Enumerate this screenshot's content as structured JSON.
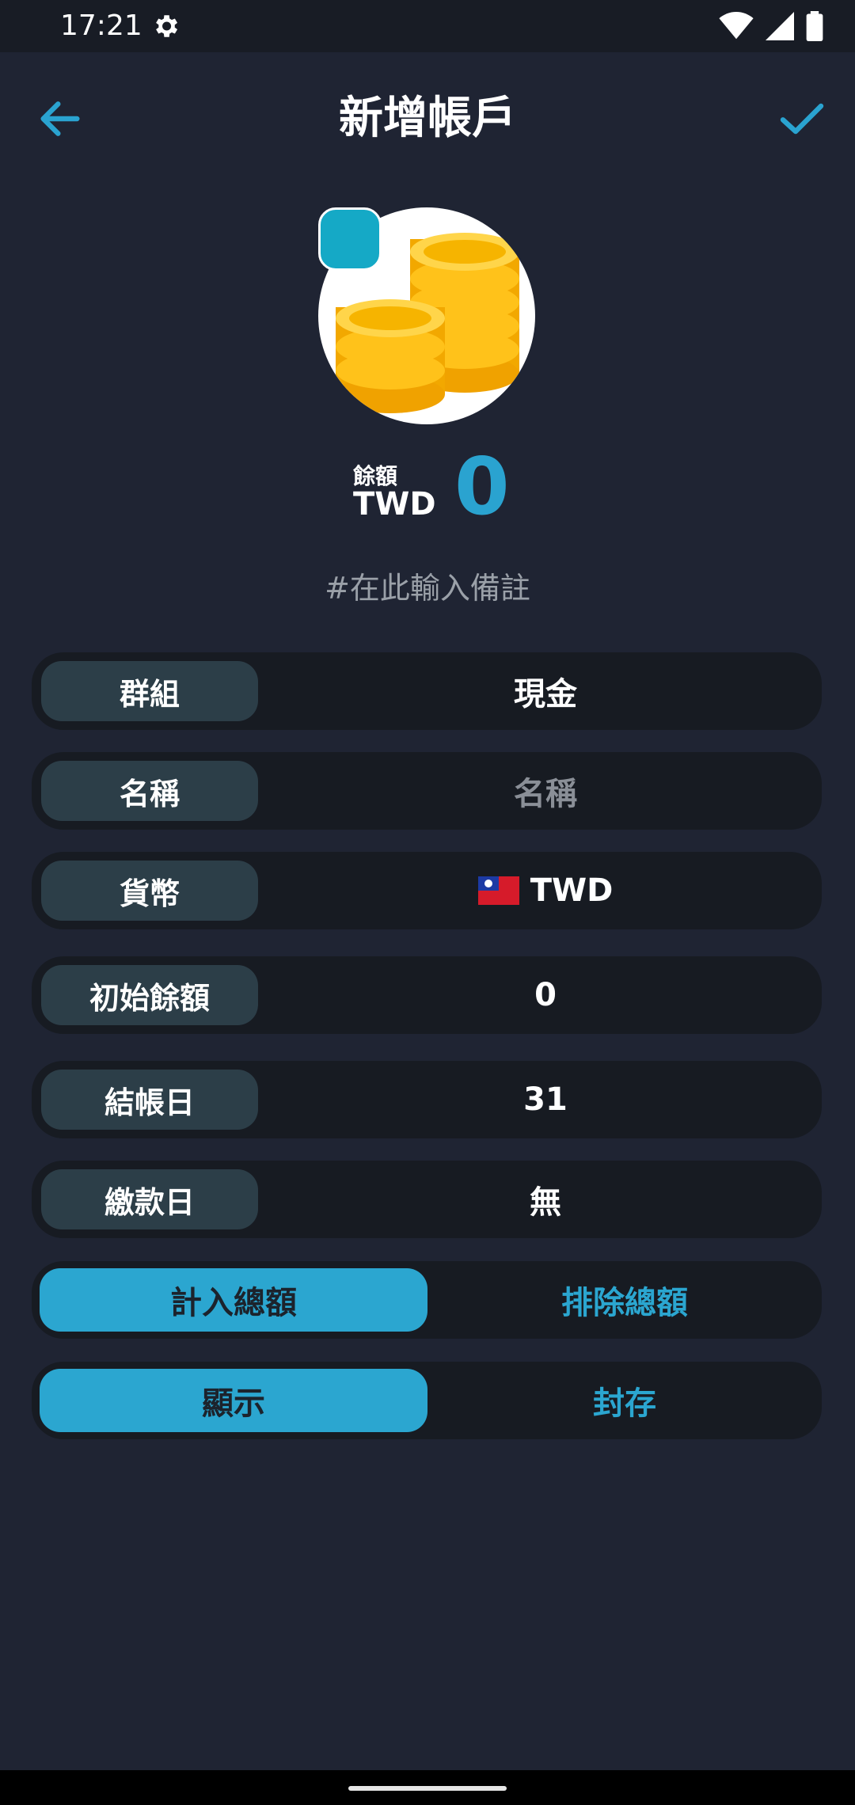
{
  "status": {
    "time": "17:21"
  },
  "header": {
    "title": "新增帳戶"
  },
  "account": {
    "color": "#15a9c6",
    "icon": "coins-icon",
    "balance_label": "餘額",
    "balance_currency": "TWD",
    "balance_value": "0",
    "note_placeholder": "#在此輸入備註"
  },
  "fields": {
    "group": {
      "label": "群組",
      "value": "現金"
    },
    "name": {
      "label": "名稱",
      "placeholder": "名稱"
    },
    "currency": {
      "label": "貨幣",
      "value": "TWD",
      "flag": "taiwan-flag-icon"
    },
    "initial_balance": {
      "label": "初始餘額",
      "value": "0"
    },
    "statement_day": {
      "label": "結帳日",
      "value": "31"
    },
    "payment_day": {
      "label": "繳款日",
      "value": "無"
    }
  },
  "toggles": {
    "total": {
      "selected": "計入總額",
      "other": "排除總額"
    },
    "visibility": {
      "selected": "顯示",
      "other": "封存"
    }
  },
  "colors": {
    "accent": "#2ba6d0",
    "background": "#1f2433",
    "row_background": "#171b22",
    "label_background": "#2c3e48"
  }
}
